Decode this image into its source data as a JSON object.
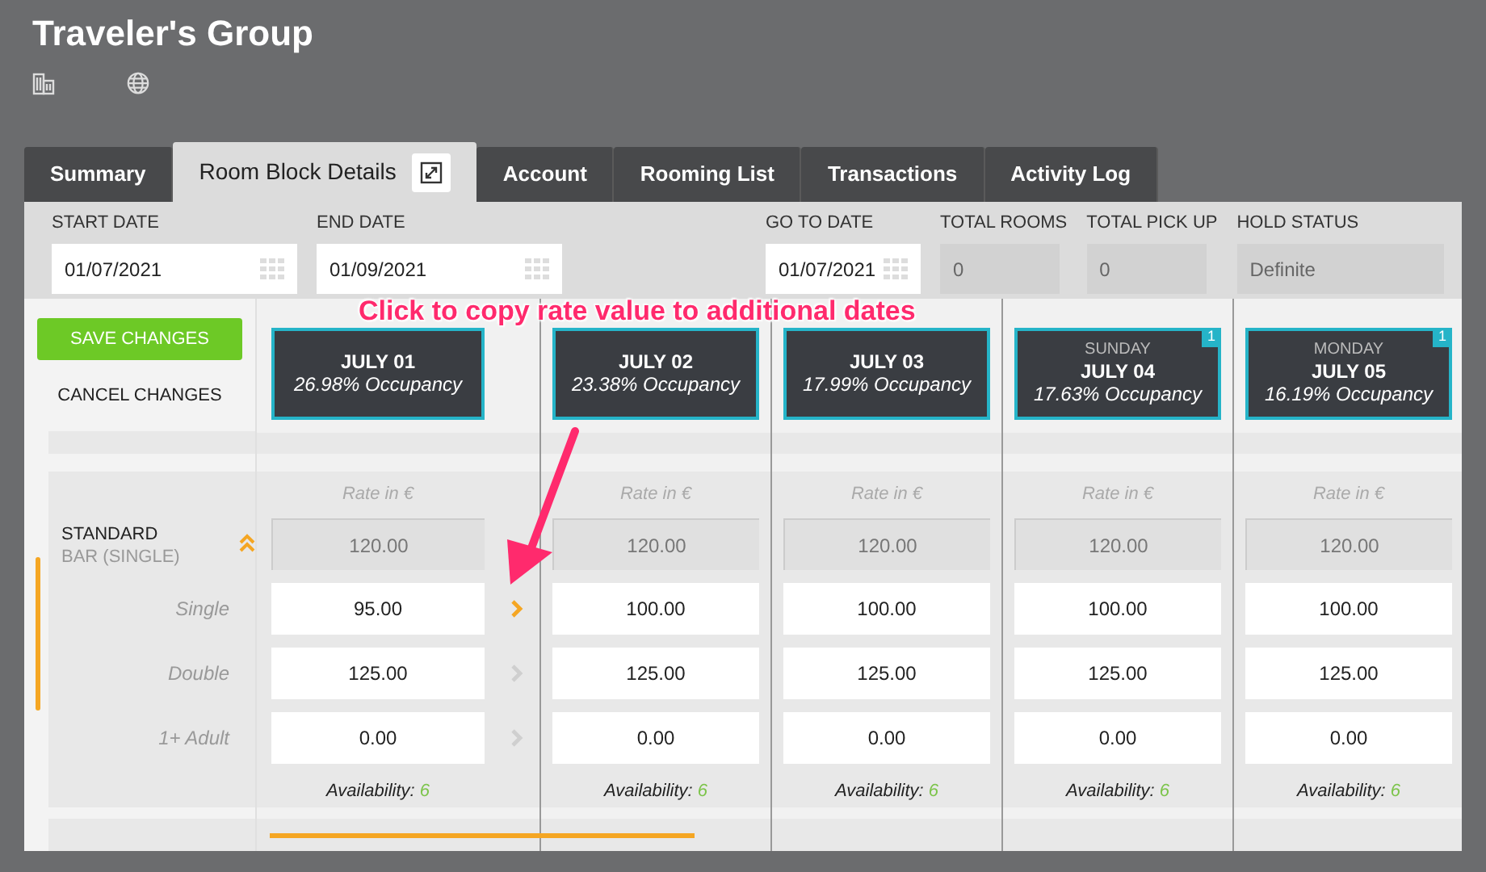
{
  "header": {
    "title": "Traveler's Group"
  },
  "tabs": [
    {
      "label": "Summary",
      "selected": false
    },
    {
      "label": "Room Block Details",
      "selected": true
    },
    {
      "label": "Account",
      "selected": false
    },
    {
      "label": "Rooming List",
      "selected": false
    },
    {
      "label": "Transactions",
      "selected": false
    },
    {
      "label": "Activity Log",
      "selected": false
    }
  ],
  "fields": [
    {
      "label": "START DATE",
      "value": "01/07/2021",
      "kind": "date"
    },
    {
      "label": "END DATE",
      "value": "01/09/2021",
      "kind": "date"
    },
    {
      "label": "GO TO DATE",
      "value": "01/07/2021",
      "kind": "date"
    },
    {
      "label": "TOTAL ROOMS",
      "value": "0",
      "kind": "readonly"
    },
    {
      "label": "TOTAL PICK UP",
      "value": "0",
      "kind": "readonly"
    },
    {
      "label": "HOLD STATUS",
      "value": "Definite",
      "kind": "readonly"
    }
  ],
  "actions": {
    "save": "SAVE CHANGES",
    "cancel": "CANCEL CHANGES"
  },
  "room_type": {
    "name": "STANDARD",
    "rate_plan": "BAR (SINGLE)",
    "expanded": true
  },
  "occupancies": [
    {
      "label": "Single",
      "copy_highlighted": true
    },
    {
      "label": "Double",
      "copy_highlighted": false
    },
    {
      "label": "1+ Adult",
      "copy_highlighted": false
    }
  ],
  "days": [
    {
      "date": "JULY 01",
      "occupancy": "26.98% Occupancy",
      "rate_label": "Rate in €",
      "base_rate": "120.00",
      "rates": [
        "95.00",
        "125.00",
        "0.00"
      ],
      "availability_label": "Availability:",
      "availability": "6"
    },
    {
      "date": "JULY 02",
      "occupancy": "23.38% Occupancy",
      "rate_label": "Rate in €",
      "base_rate": "120.00",
      "rates": [
        "100.00",
        "125.00",
        "0.00"
      ],
      "availability_label": "Availability:",
      "availability": "6"
    },
    {
      "date": "JULY 03",
      "occupancy": "17.99% Occupancy",
      "rate_label": "Rate in €",
      "base_rate": "120.00",
      "rates": [
        "100.00",
        "125.00",
        "0.00"
      ],
      "availability_label": "Availability:",
      "availability": "6"
    },
    {
      "weekday": "SUNDAY",
      "date": "JULY 04",
      "occupancy": "17.63% Occupancy",
      "badge": "1",
      "rate_label": "Rate in €",
      "base_rate": "120.00",
      "rates": [
        "100.00",
        "125.00",
        "0.00"
      ],
      "availability_label": "Availability:",
      "availability": "6"
    },
    {
      "weekday": "MONDAY",
      "date": "JULY 05",
      "occupancy": "16.19% Occupancy",
      "badge": "1",
      "rate_label": "Rate in €",
      "base_rate": "120.00",
      "rates": [
        "100.00",
        "125.00",
        "0.00"
      ],
      "availability_label": "Availability:",
      "availability": "6"
    }
  ],
  "annotation": {
    "text": "Click to copy rate value to additional dates"
  }
}
